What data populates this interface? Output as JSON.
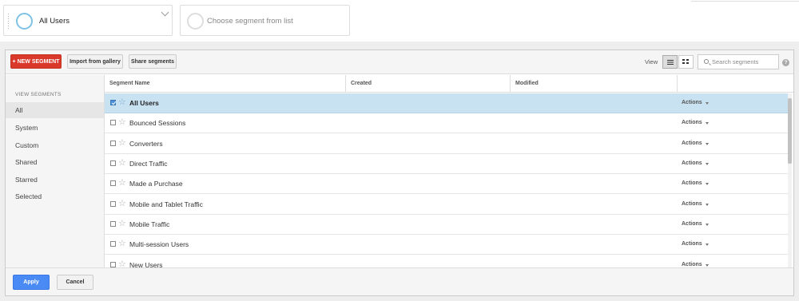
{
  "segment_bar": {
    "active_segment": "All Users",
    "empty_slot_placeholder": "Choose segment from list"
  },
  "toolbar": {
    "new_segment_label": "+ NEW SEGMENT",
    "import_label": "Import from gallery",
    "share_label": "Share segments",
    "view_label": "View",
    "view_mode": "list",
    "search_placeholder": "Search segments",
    "help_label": "?"
  },
  "sidebar": {
    "header": "VIEW SEGMENTS",
    "selected_index": 0,
    "items": [
      "All",
      "System",
      "Custom",
      "Shared",
      "Starred",
      "Selected"
    ]
  },
  "table": {
    "columns": [
      "Segment Name",
      "Created",
      "Modified"
    ],
    "rows": [
      {
        "name": "All Users",
        "checked": true,
        "selected": true,
        "created": "",
        "modified": "",
        "actions": "Actions"
      },
      {
        "name": "Bounced Sessions",
        "checked": false,
        "selected": false,
        "created": "",
        "modified": "",
        "actions": "Actions"
      },
      {
        "name": "Converters",
        "checked": false,
        "selected": false,
        "created": "",
        "modified": "",
        "actions": "Actions"
      },
      {
        "name": "Direct Traffic",
        "checked": false,
        "selected": false,
        "created": "",
        "modified": "",
        "actions": "Actions"
      },
      {
        "name": "Made a Purchase",
        "checked": false,
        "selected": false,
        "created": "",
        "modified": "",
        "actions": "Actions"
      },
      {
        "name": "Mobile and Tablet Traffic",
        "checked": false,
        "selected": false,
        "created": "",
        "modified": "",
        "actions": "Actions"
      },
      {
        "name": "Mobile Traffic",
        "checked": false,
        "selected": false,
        "created": "",
        "modified": "",
        "actions": "Actions"
      },
      {
        "name": "Multi-session Users",
        "checked": false,
        "selected": false,
        "created": "",
        "modified": "",
        "actions": "Actions"
      },
      {
        "name": "New Users",
        "checked": false,
        "selected": false,
        "created": "",
        "modified": "",
        "actions": "Actions"
      }
    ]
  },
  "footer": {
    "apply_label": "Apply",
    "cancel_label": "Cancel"
  },
  "colors": {
    "new_segment": "#d9392b",
    "apply": "#4a8af4",
    "selected_row": "#c8e2f2",
    "segment_ring": "#7fc2e6"
  }
}
